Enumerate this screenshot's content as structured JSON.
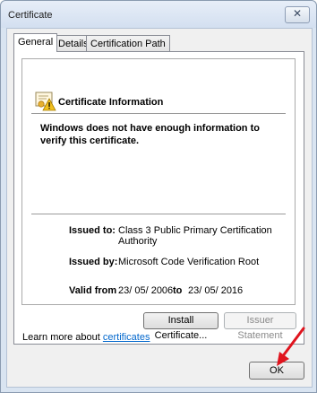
{
  "window": {
    "title": "Certificate",
    "close_glyph": "✕"
  },
  "tabs": [
    {
      "label": "General",
      "active": true
    },
    {
      "label": "Details",
      "active": false
    },
    {
      "label": "Certification Path",
      "active": false
    }
  ],
  "info": {
    "heading": "Certificate Information",
    "message": "Windows does not have enough information to verify this certificate.",
    "issued_to_label": "Issued to:",
    "issued_to_value": "Class 3 Public Primary Certification Authority",
    "issued_by_label": "Issued by:",
    "issued_by_value": "Microsoft Code Verification Root",
    "valid_from_label": "Valid from",
    "valid_from_value": "23/ 05/ 2006",
    "valid_to_label": "to",
    "valid_to_value": "23/ 05/ 2016"
  },
  "buttons": {
    "install": "Install Certificate...",
    "issuer_statement": "Issuer Statement",
    "ok": "OK"
  },
  "learn_more": {
    "prefix": "Learn more about ",
    "link": "certificates"
  },
  "icons": {
    "certificate": "certificate-warning-icon",
    "arrow": "red-arrow-icon"
  },
  "colors": {
    "link": "#0066cc",
    "arrow": "#e0141e",
    "warning": "#f2c01e"
  }
}
